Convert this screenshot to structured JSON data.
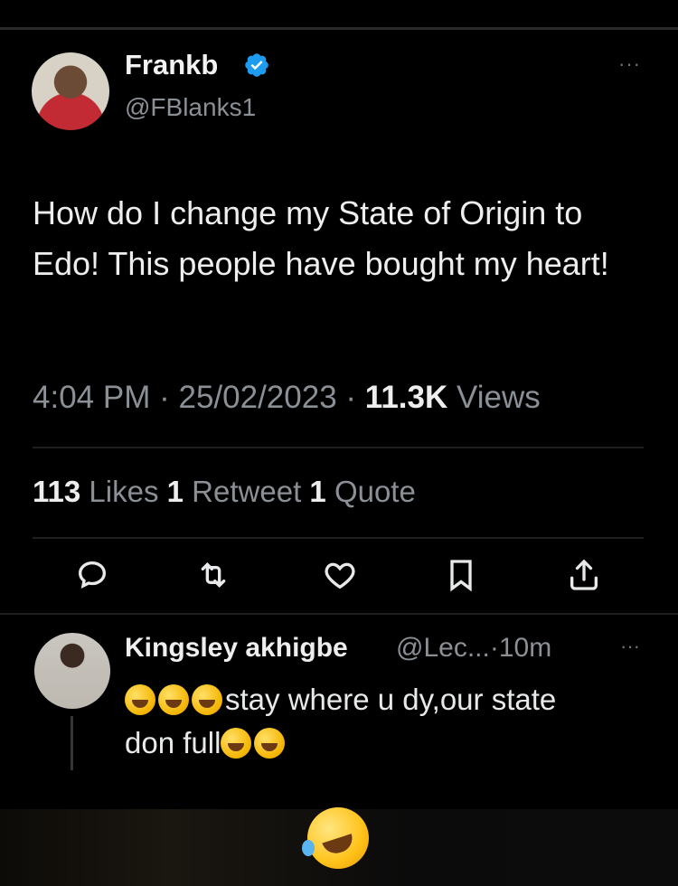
{
  "tweet": {
    "author": {
      "name": "Frankb",
      "handle": "@FBlanks1",
      "verified": true
    },
    "text": "How do I change my State of Origin to Edo! This people have bought my heart!",
    "time": "4:04 PM",
    "date": "25/02/2023",
    "views_count": "11.3K",
    "views_label": "Views",
    "separator": "·",
    "stats": {
      "likes_count": "113",
      "likes_label": "Likes",
      "retweets_count": "1",
      "retweets_label": "Retweet",
      "quotes_count": "1",
      "quotes_label": "Quote"
    },
    "actions": [
      "reply-icon",
      "retweet-icon",
      "like-icon",
      "bookmark-icon",
      "share-icon"
    ],
    "more": "···"
  },
  "reply": {
    "author_name": "Kingsley akhigbe",
    "handle_time": "@Lec...·10m",
    "more": "···",
    "text_line1": "stay where u dy,our state",
    "text_line2": "don full"
  },
  "colors": {
    "background": "#000000",
    "verified": "#1d9bf0",
    "muted": "#8b9096",
    "text": "#e7e9ea"
  },
  "icons": {
    "verified": "verified-badge-icon",
    "emoji": "rolling-on-floor-laughing-emoji"
  }
}
